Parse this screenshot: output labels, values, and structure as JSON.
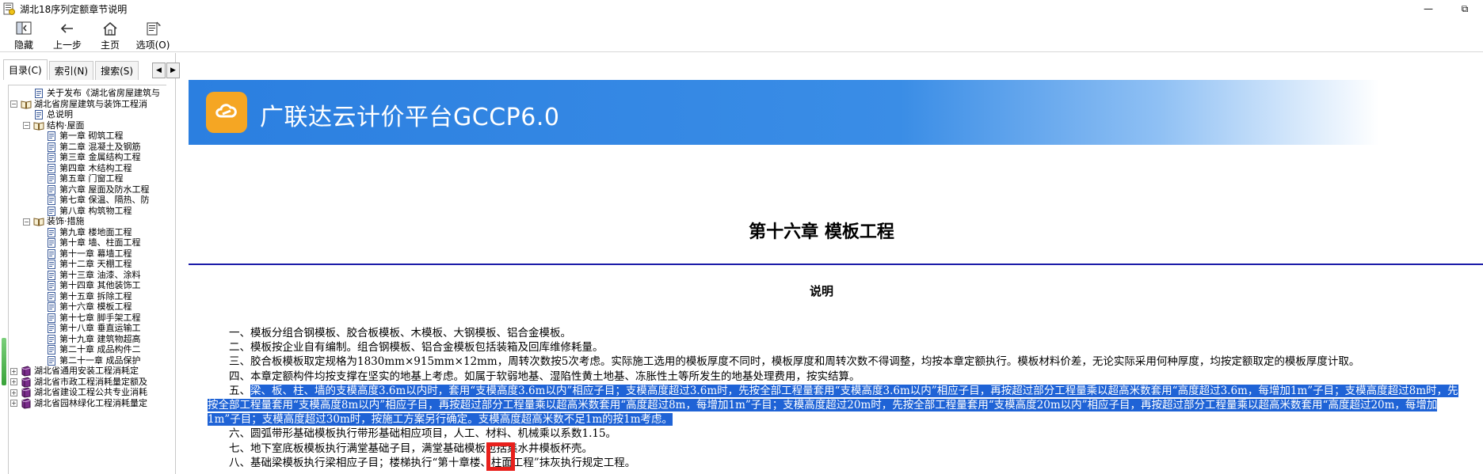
{
  "window": {
    "title": "湖北18序列定额章节说明",
    "restore_glyph": "⧉",
    "minimize_glyph": "—"
  },
  "toolbar": {
    "hide_label": "隐藏",
    "back_label": "上一步",
    "home_label": "主页",
    "options_label": "选项(O)"
  },
  "sidebar": {
    "tabs": [
      "目录(C)",
      "索引(N)",
      "搜索(S)"
    ],
    "arrow_left": "◀",
    "arrow_right": "▶",
    "tree": [
      {
        "level": 1,
        "expander": "",
        "icon": "page",
        "label": "关于发布《湖北省房屋建筑与"
      },
      {
        "level": 0,
        "expander": "−",
        "icon": "open-book",
        "label": "湖北省房屋建筑与装饰工程消"
      },
      {
        "level": 1,
        "expander": "",
        "icon": "page",
        "label": "总说明"
      },
      {
        "level": 1,
        "expander": "−",
        "icon": "open-book",
        "label": "结构·屋面"
      },
      {
        "level": 2,
        "expander": "",
        "icon": "page",
        "label": "第一章  砌筑工程"
      },
      {
        "level": 2,
        "expander": "",
        "icon": "page",
        "label": "第二章  混凝土及钢筋"
      },
      {
        "level": 2,
        "expander": "",
        "icon": "page",
        "label": "第三章  金属结构工程"
      },
      {
        "level": 2,
        "expander": "",
        "icon": "page",
        "label": "第四章  木结构工程"
      },
      {
        "level": 2,
        "expander": "",
        "icon": "page",
        "label": "第五章  门窗工程"
      },
      {
        "level": 2,
        "expander": "",
        "icon": "page",
        "label": "第六章  屋面及防水工程"
      },
      {
        "level": 2,
        "expander": "",
        "icon": "page",
        "label": "第七章  保温、隔热、防"
      },
      {
        "level": 2,
        "expander": "",
        "icon": "page",
        "label": "第八章  构筑物工程"
      },
      {
        "level": 1,
        "expander": "−",
        "icon": "open-book",
        "label": "装饰·措施"
      },
      {
        "level": 2,
        "expander": "",
        "icon": "page",
        "label": "第九章  楼地面工程"
      },
      {
        "level": 2,
        "expander": "",
        "icon": "page",
        "label": "第十章  墙、柱面工程"
      },
      {
        "level": 2,
        "expander": "",
        "icon": "page",
        "label": "第十一章  幕墙工程"
      },
      {
        "level": 2,
        "expander": "",
        "icon": "page",
        "label": "第十二章  天棚工程"
      },
      {
        "level": 2,
        "expander": "",
        "icon": "page",
        "label": "第十三章  油漆、涂料"
      },
      {
        "level": 2,
        "expander": "",
        "icon": "page",
        "label": "第十四章  其他装饰工"
      },
      {
        "level": 2,
        "expander": "",
        "icon": "page",
        "label": "第十五章  拆除工程"
      },
      {
        "level": 2,
        "expander": "",
        "icon": "page",
        "label": "第十六章  模板工程"
      },
      {
        "level": 2,
        "expander": "",
        "icon": "page",
        "label": "第十七章  脚手架工程"
      },
      {
        "level": 2,
        "expander": "",
        "icon": "page",
        "label": "第十八章  垂直运输工"
      },
      {
        "level": 2,
        "expander": "",
        "icon": "page",
        "label": "第十九章  建筑物超高"
      },
      {
        "level": 2,
        "expander": "",
        "icon": "page",
        "label": "第二十章  成品构件二"
      },
      {
        "level": 2,
        "expander": "",
        "icon": "page",
        "label": "第二十一章  成品保护"
      },
      {
        "level": 0,
        "expander": "+",
        "icon": "book",
        "label": "湖北省通用安装工程消耗定"
      },
      {
        "level": 0,
        "expander": "+",
        "icon": "book",
        "label": "湖北省市政工程消耗量定额及"
      },
      {
        "level": 0,
        "expander": "+",
        "icon": "book",
        "label": "湖北省建设工程公共专业消耗"
      },
      {
        "level": 0,
        "expander": "+",
        "icon": "book",
        "label": "湖北省园林绿化工程消耗量定"
      }
    ]
  },
  "content": {
    "banner_text": "广联达云计价平台GCCP6.0",
    "chapter_title": "第十六章  模板工程",
    "section_title": "说明",
    "paragraphs": {
      "p1": "一、模板分组合钢模板、胶合板模板、木模板、大钢模板、铝合金模板。",
      "p2": "二、模板按企业自有编制。组合钢模板、铝合金模板包括装箱及回库维修耗量。",
      "p3": "三、胶合板模板取定规格为1830mm×915mm×12mm，周转次数按5次考虑。实际施工选用的模板厚度不同时，模板厚度和周转次数不得调整，均按本章定额执行。模板材料价差，无论实际采用何种厚度，均按定额取定的模板厚度计取。",
      "p4": "四、本章定额构件均按支撑在坚实的地基上考虑。如属于软弱地基、湿陷性黄土地基、冻胀性土等所发生的地基处理费用，按实结算。",
      "p5_pre": "五、",
      "p5_sel": "梁、板、柱、墙的支模高度3.6m以内时，套用“支模高度3.6m以内”相应子目；支模高度超过3.6m时，先按全部工程量套用“支模高度3.6m以内”相应子目，再按超过部分工程量乘以超高米数套用“高度超过3.6m，每增加1m”子目；支模高度超过8m时，先按全部工程量套用“支模高度8m以内”相应子目，再按超过部分工程量乘以超高米数套用“高度超过8m，每增加1m”子目；支模高度超过20m时，先按全部工程量套用“支模高度20m以内”相应子目，再按超过部分工程量乘以超高米数套用“高度超过20m，每增加1m”子目；支模高度超过30m时，按施工方案另行确定。支模高度超高米数不足1m的按1m考虑。",
      "p6": "六、圆弧带形基础模板执行带形基础相应项目，人工、材料、机械乘以系数1.15。",
      "p7": "七、地下室底板模板执行满堂基础子目，满堂基础模板包括集水井模板杯壳。",
      "p8": "八、基础梁模板执行梁相应子目；楼梯执行“第十章楼、柱面工程”抹灰执行规定工程。"
    }
  },
  "colors": {
    "banner_blue": "#2b7fe0",
    "logo_orange": "#f5a623",
    "selection_blue": "#1f63d6",
    "rule_blue": "#1a1aa8",
    "marker_red": "#e8201c"
  }
}
